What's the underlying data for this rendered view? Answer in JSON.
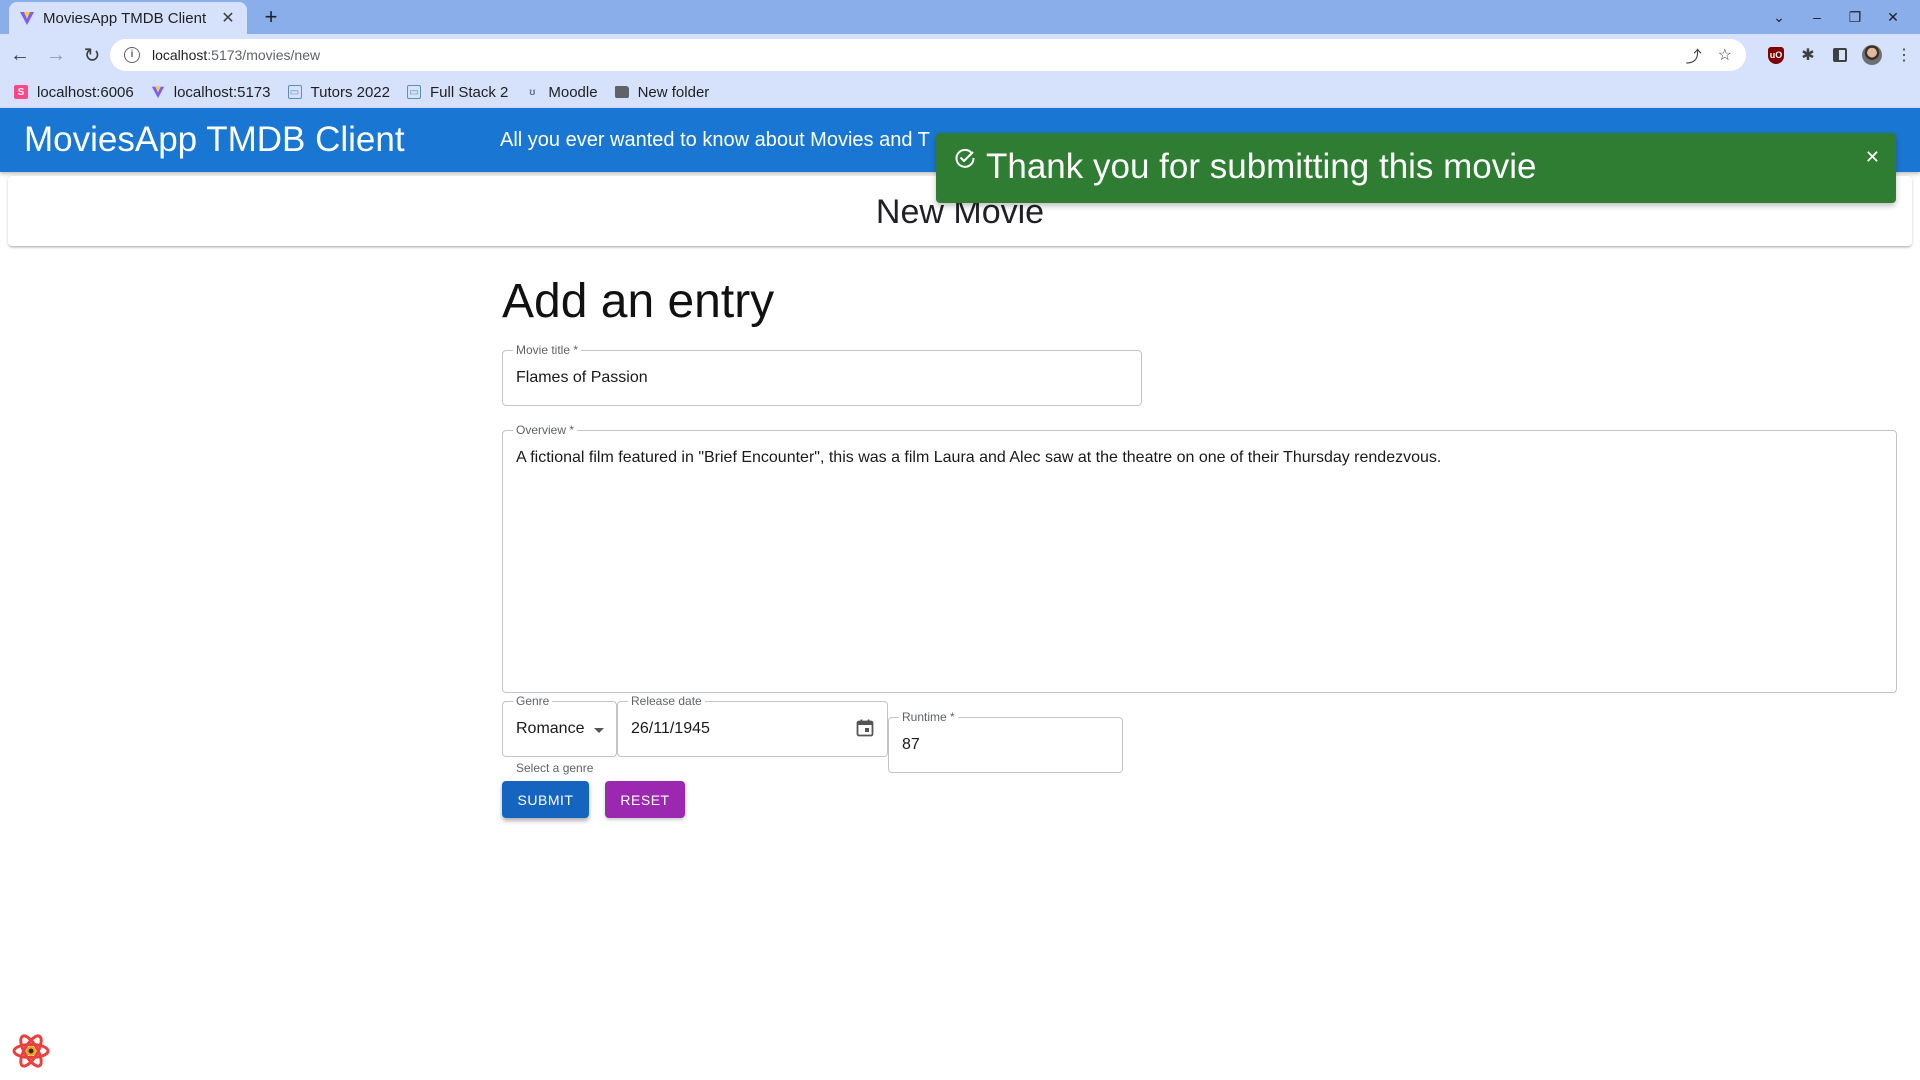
{
  "browser": {
    "tab_title": "MoviesApp TMDB Client",
    "tab_close": "✕",
    "new_tab": "+",
    "url_host": "localhost",
    "url_rest": ":5173/movies/new",
    "bookmarks": [
      {
        "label": "localhost:6006",
        "icon": "storybook-icon"
      },
      {
        "label": "localhost:5173",
        "icon": "vite-icon"
      },
      {
        "label": "Tutors 2022",
        "icon": "tutors-icon"
      },
      {
        "label": "Full Stack 2",
        "icon": "tutors-icon"
      },
      {
        "label": "Moodle",
        "icon": "moodle-icon"
      },
      {
        "label": "New folder",
        "icon": "folder-icon"
      }
    ]
  },
  "app": {
    "title": "MoviesApp TMDB Client",
    "tagline": "All you ever wanted to know about Movies and T",
    "brand_color": "#1976d2"
  },
  "page": {
    "header": "New Movie",
    "form_heading": "Add an entry"
  },
  "form": {
    "title": {
      "label": "Movie title *",
      "value": "Flames of Passion"
    },
    "overview": {
      "label": "Overview *",
      "value": "A fictional film featured in \"Brief Encounter\", this was a film Laura and Alec saw at the theatre on one of their Thursday rendezvous."
    },
    "genre": {
      "label": "Genre",
      "value": "Romance",
      "helper": "Select a genre"
    },
    "release_date": {
      "label": "Release date",
      "value": "26/11/1945"
    },
    "runtime": {
      "label": "Runtime *",
      "value": "87"
    },
    "submit_label": "SUBMIT",
    "reset_label": "RESET"
  },
  "snackbar": {
    "message": "Thank you for submitting this movie",
    "color": "#2e7d32",
    "close": "✕"
  }
}
